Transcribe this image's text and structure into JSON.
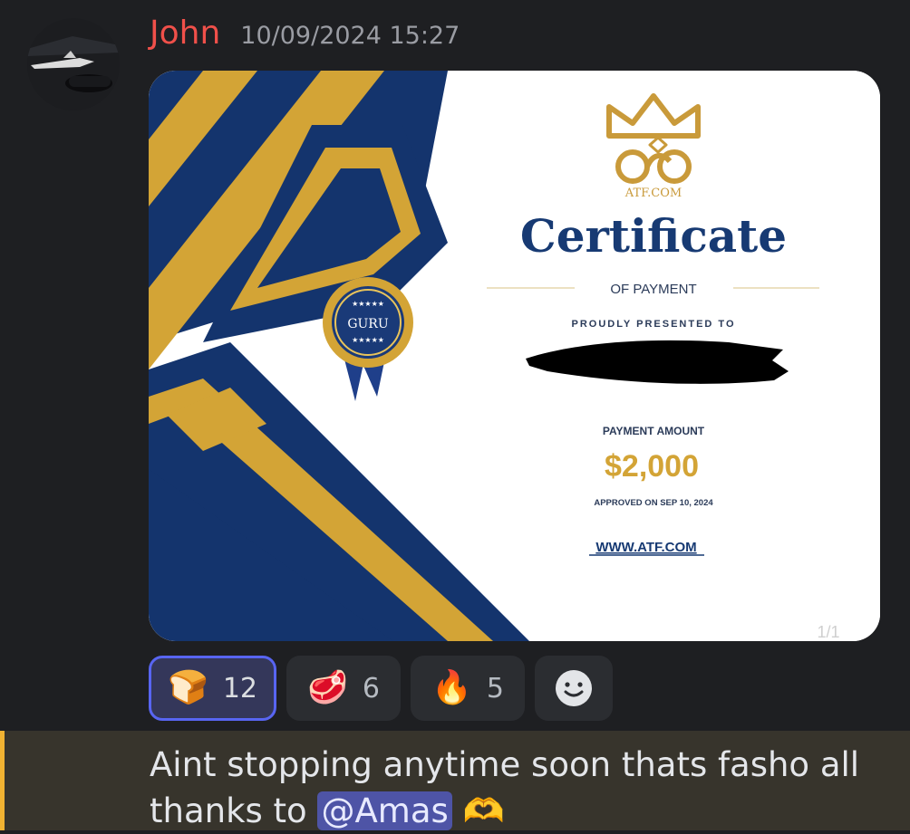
{
  "message": {
    "author": "John",
    "timestamp": "10/09/2024 15:27",
    "attachment": {
      "brand": "ATF.COM",
      "title": "Certificate",
      "subtitle": "OF PAYMENT",
      "presented": "PROUDLY PRESENTED TO",
      "amount_label": "PAYMENT AMOUNT",
      "amount": "$2,000",
      "approved": "APPROVED ON SEP 10, 2024",
      "url": "WWW.ATF.COM",
      "seal_text": "GURU",
      "page_indicator": "1/1"
    }
  },
  "reactions": [
    {
      "emoji": "🍞",
      "count": "12",
      "active": true
    },
    {
      "emoji": "🥩",
      "count": "6",
      "active": false
    },
    {
      "emoji": "🔥",
      "count": "5",
      "active": false
    }
  ],
  "next_message": {
    "text": "Aint stopping anytime soon thats fasho all thanks to",
    "mention": "@Amas",
    "emoji": "🫶"
  },
  "colors": {
    "navy": "#14346d",
    "gold": "#d3a436",
    "username": "#f0504a",
    "mention_bg": "#4e54a6",
    "highlight_bar": "#f0b232"
  }
}
